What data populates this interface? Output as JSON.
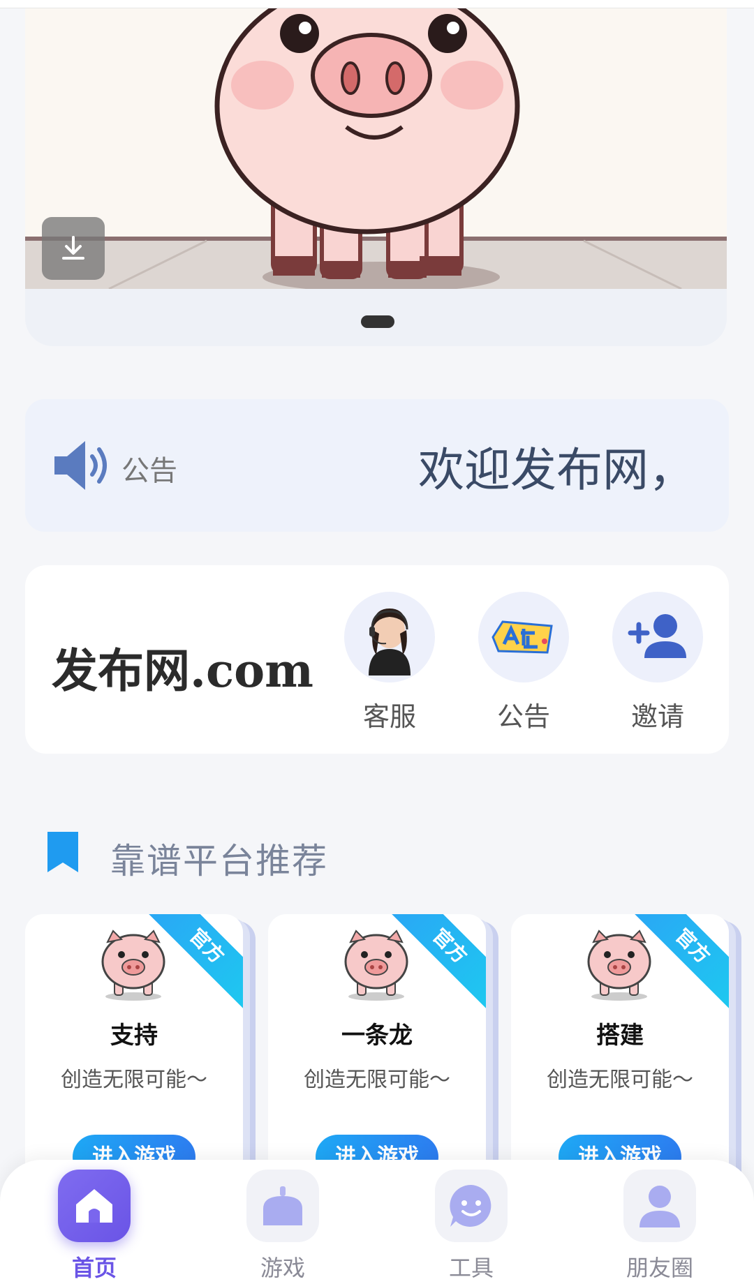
{
  "banner": {
    "download_icon": "download-icon",
    "page_dots": 1
  },
  "notice": {
    "label": "公告",
    "text": "欢迎发布网，"
  },
  "site": {
    "title": "发布网.com",
    "actions": [
      {
        "label": "客服",
        "icon": "customer-service-avatar"
      },
      {
        "label": "公告",
        "icon": "announcement-badge-icon"
      },
      {
        "label": "邀请",
        "icon": "add-user-icon"
      }
    ]
  },
  "section": {
    "title": "靠谱平台推荐"
  },
  "platforms": [
    {
      "name": "支持",
      "desc": "创造无限可能～",
      "badge": "官方",
      "button": "进入游戏"
    },
    {
      "name": "一条龙",
      "desc": "创造无限可能～",
      "badge": "官方",
      "button": "进入游戏"
    },
    {
      "name": "搭建",
      "desc": "创造无限可能～",
      "badge": "官方",
      "button": "进入游戏"
    }
  ],
  "tabbar": [
    {
      "label": "首页",
      "icon": "home-icon",
      "active": true
    },
    {
      "label": "游戏",
      "icon": "gamepad-icon",
      "active": false
    },
    {
      "label": "工具",
      "icon": "chat-smile-icon",
      "active": false
    },
    {
      "label": "朋友圈",
      "icon": "user-icon",
      "active": false
    }
  ],
  "colors": {
    "accent": "#6a54e6",
    "ribbon": "#2aa6f5",
    "notice_bg": "#eef2fb"
  }
}
